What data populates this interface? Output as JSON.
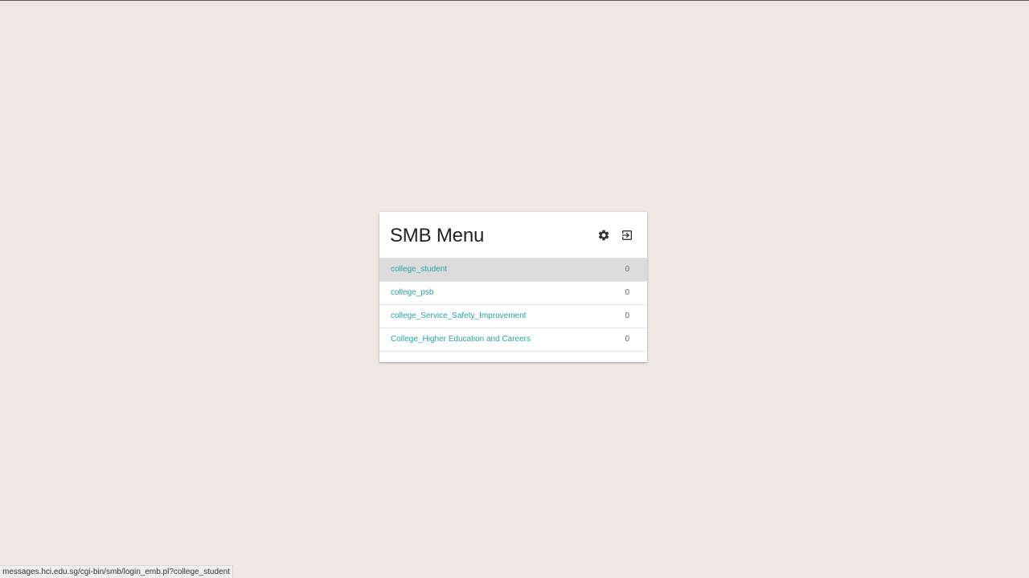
{
  "menu": {
    "title": "SMB Menu",
    "settings_icon": "gear-icon",
    "logout_icon": "logout-icon",
    "items": [
      {
        "label": "college_student",
        "count": "0",
        "active": true
      },
      {
        "label": "college_psb",
        "count": "0",
        "active": false
      },
      {
        "label": "college_Service_Safety_Improvement",
        "count": "0",
        "active": false
      },
      {
        "label": "College_Higher Education and Careers",
        "count": "0",
        "active": false
      }
    ]
  },
  "status_bar": {
    "url": "messages.hci.edu.sg/cgi-bin/smb/login_emb.pl?college_student"
  },
  "colors": {
    "background": "#ede8e4",
    "accent": "#26a69a",
    "active_row": "#dcdcdc"
  }
}
